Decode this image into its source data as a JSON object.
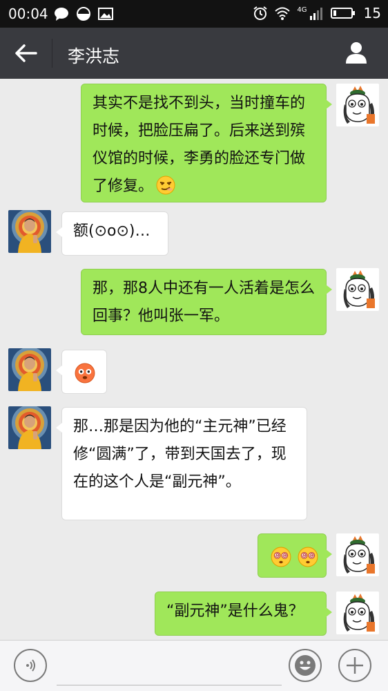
{
  "status_bar": {
    "time": "00:04",
    "network": "4G",
    "battery": "15"
  },
  "header": {
    "contact_name": "李洪志"
  },
  "messages": [
    {
      "side": "right",
      "text": "其实不是找不到头，当时撞车的时候，把脸压扁了。后来送到殡仪馆的时候，李勇的脸还专门做了修复。",
      "emoji": "smirk-emoji"
    },
    {
      "side": "left",
      "text": "额(⊙o⊙)…"
    },
    {
      "side": "right",
      "text": "那，那8人中还有一人活着是怎么回事？他叫张一军。"
    },
    {
      "side": "left",
      "text": "",
      "emoji": "flushed-emoji"
    },
    {
      "side": "left",
      "text": "那…那是因为他的“主元神”已经修“圆满”了，带到天国去了，现在的这个人是“副元神”。"
    },
    {
      "side": "right",
      "text": "",
      "emoji": "dizzy-eyes-emoji x2"
    },
    {
      "side": "right",
      "text": "“副元神”是什么鬼？"
    }
  ],
  "colors": {
    "sent_bubble": "#a0e75a",
    "received_bubble": "#ffffff",
    "nav_bar": "#393a3f",
    "chat_background": "#ebebeb"
  }
}
